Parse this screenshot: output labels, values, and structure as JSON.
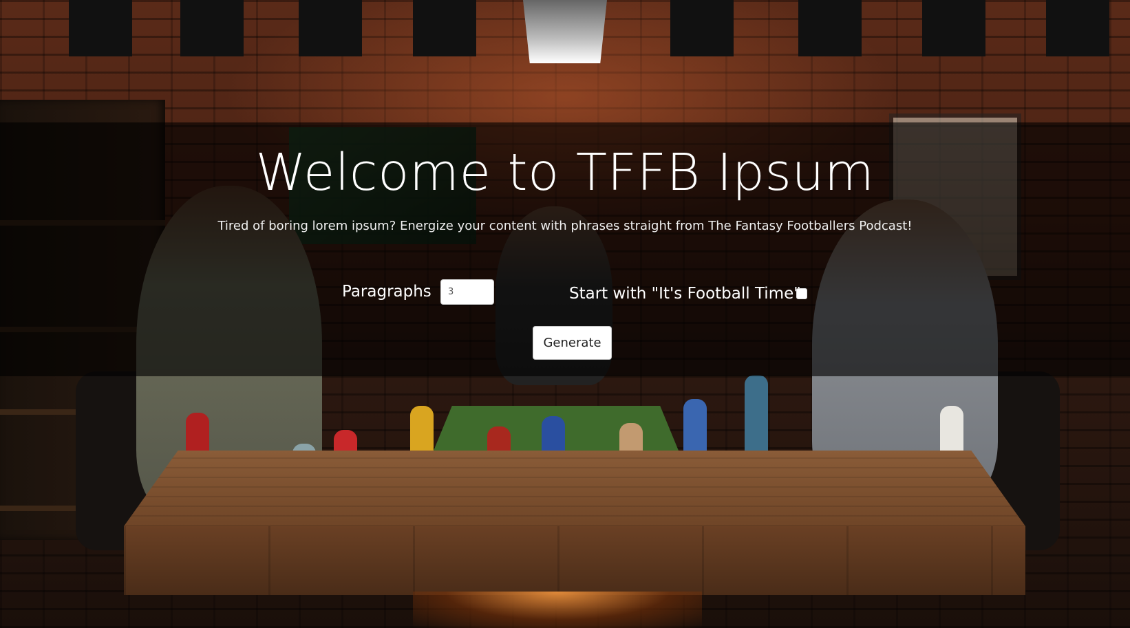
{
  "hero": {
    "title": "Welcome to TFFB Ipsum",
    "subtitle": "Tired of boring lorem ipsum? Energize your content with phrases straight from The Fantasy Footballers Podcast!"
  },
  "form": {
    "paragraphs_label": "Paragraphs",
    "paragraphs_value": "3",
    "football_time_label": "Start with \"It's Football Time\"",
    "football_time_checked": false,
    "generate_label": "Generate"
  },
  "background": {
    "description_icon": "studio-photo-background",
    "overlay_color": "#000000"
  }
}
